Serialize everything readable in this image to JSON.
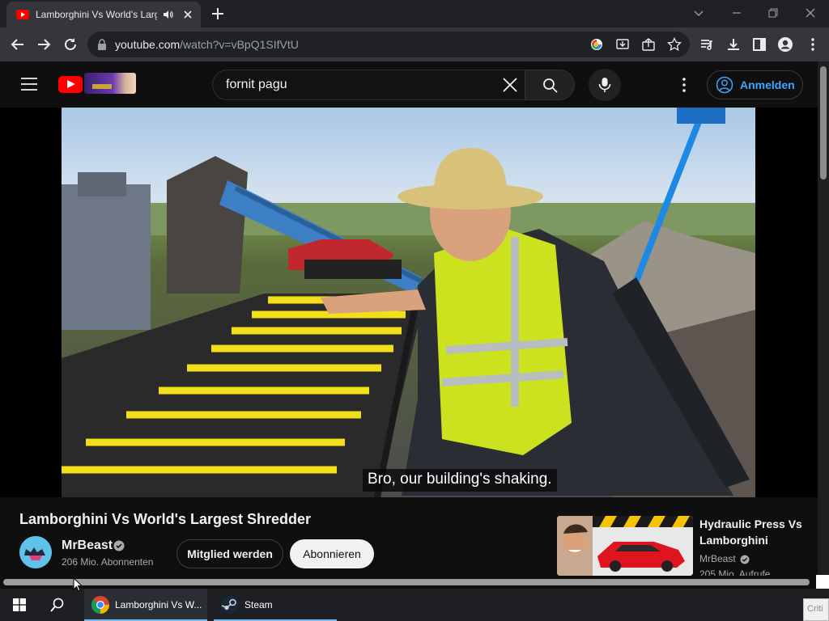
{
  "browser": {
    "tab_title": "Lamborghini Vs World's Largest Shredder",
    "url_host": "youtube.com",
    "url_path": "/watch?v=vBpQ1SIfVtU"
  },
  "youtube": {
    "search_query": "fornit pagu",
    "sign_in_label": "Anmelden"
  },
  "video": {
    "caption": "Bro, our building's shaking.",
    "title": "Lamborghini Vs World's Largest Shredder",
    "channel": "MrBeast",
    "subscribers": "206 Mio. Abonnenten",
    "join_label": "Mitglied werden",
    "subscribe_label": "Abonnieren"
  },
  "related": {
    "title": "Hydraulic Press Vs Lamborghini",
    "channel": "MrBeast",
    "views": "205 Mio. Aufrufe"
  },
  "taskbar": {
    "chrome_label": "Lamborghini Vs W...",
    "steam_label": "Steam",
    "tray_text": "Criti"
  },
  "colors": {
    "yt_red": "#ff0000",
    "link_blue": "#3ea6ff",
    "page_bg": "#0f0f0f"
  }
}
